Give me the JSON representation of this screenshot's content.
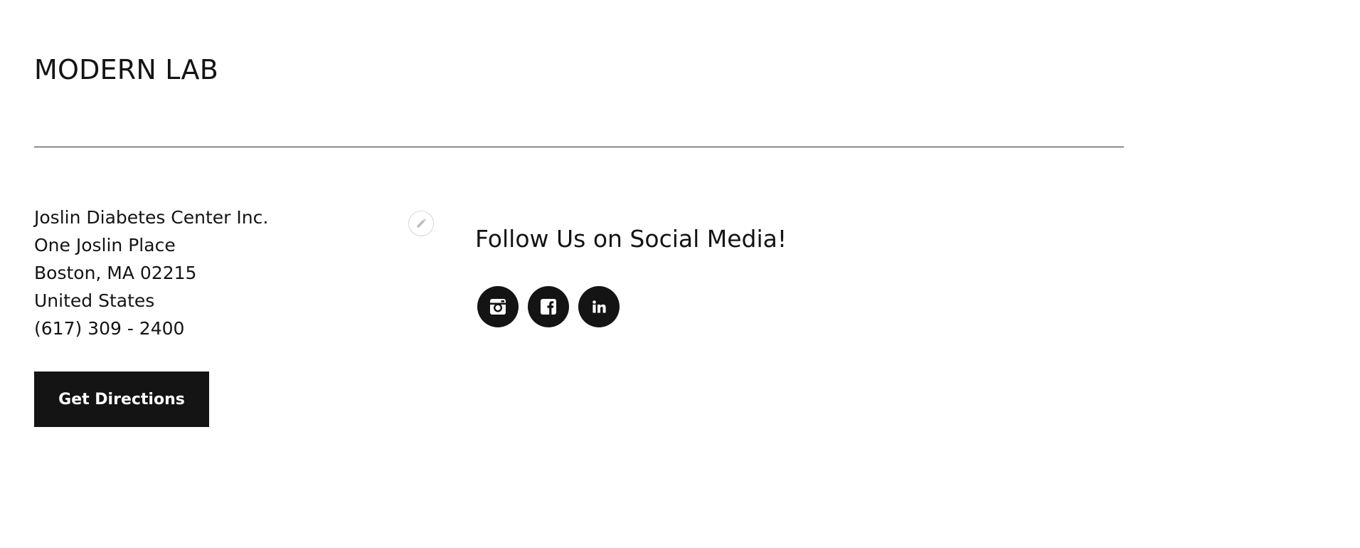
{
  "header": {
    "title": "MODERN LAB"
  },
  "location": {
    "lines": [
      "Joslin Diabetes Center Inc.",
      "One Joslin Place",
      "Boston, MA 02215",
      "United States",
      "(617) 309 - 2400"
    ],
    "directions_label": "Get Directions",
    "edit_icon": "pencil-icon"
  },
  "social": {
    "heading": "Follow Us on Social Media!",
    "links": [
      {
        "name": "instagram",
        "icon": "instagram-icon"
      },
      {
        "name": "facebook",
        "icon": "facebook-icon"
      },
      {
        "name": "linkedin",
        "icon": "linkedin-icon"
      }
    ]
  },
  "colors": {
    "text": "#141414",
    "button_bg": "#141414",
    "button_text": "#ffffff",
    "divider": "#2a2a2a",
    "background": "#ffffff"
  }
}
